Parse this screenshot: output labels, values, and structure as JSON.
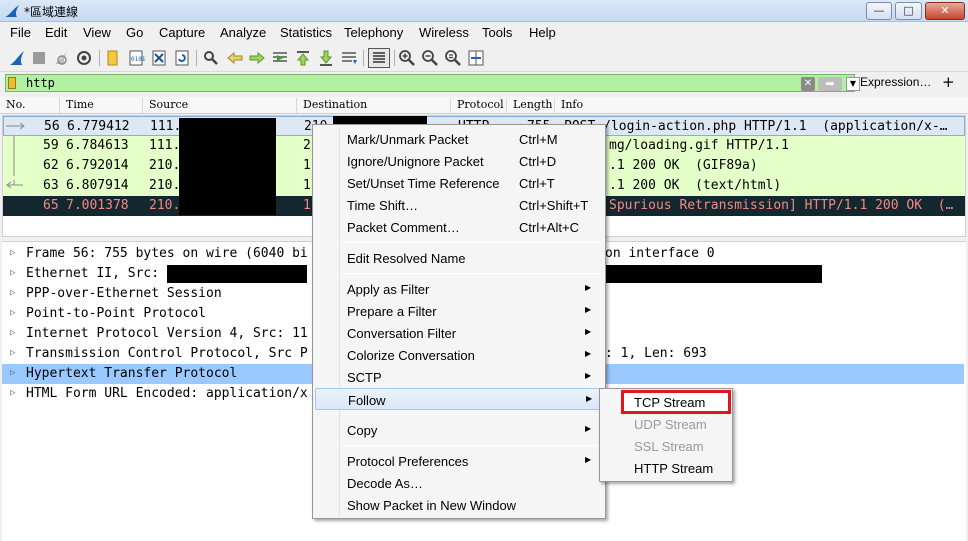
{
  "window": {
    "title": "*區域連線",
    "minimize": "—",
    "maximize": "□",
    "close": "✕"
  },
  "menu": [
    "File",
    "Edit",
    "View",
    "Go",
    "Capture",
    "Analyze",
    "Statistics",
    "Telephony",
    "Wireless",
    "Tools",
    "Help"
  ],
  "filter": {
    "value": "http",
    "clear": "✕",
    "apply": "➡",
    "dropdown": "▼",
    "expression_label": "Expression…",
    "add": "+"
  },
  "columns": [
    "No.",
    "Time",
    "Source",
    "Destination",
    "Protocol",
    "Length",
    "Info"
  ],
  "packets": [
    {
      "no": "56",
      "time": "6.779412",
      "src": "111.",
      "dst": "210",
      "proto": "HTTP",
      "len": "755",
      "info": "POST /login-action.php HTTP/1.1  (application/x-…"
    },
    {
      "no": "59",
      "time": "6.784613",
      "src": "111.",
      "dst": "2",
      "proto": "",
      "len": "",
      "info": "mg/loading.gif HTTP/1.1"
    },
    {
      "no": "62",
      "time": "6.792014",
      "src": "210.",
      "dst": "1",
      "proto": "",
      "len": "",
      "info": ".1 200 OK  (GIF89a)"
    },
    {
      "no": "63",
      "time": "6.807914",
      "src": "210.",
      "dst": "1",
      "proto": "",
      "len": "",
      "info": ".1 200 OK  (text/html)"
    },
    {
      "no": "65",
      "time": "7.001378",
      "src": "210.",
      "dst": "1",
      "proto": "",
      "len": "",
      "info": "Spurious Retransmission] HTTP/1.1 200 OK  (…"
    }
  ],
  "details": [
    {
      "left": "Frame 56: 755 bytes on wire (6040 bi",
      "right": "on interface 0"
    },
    {
      "left": "Ethernet II, Src: ",
      "right": ""
    },
    {
      "left": "PPP-over-Ethernet Session",
      "right": ""
    },
    {
      "left": "Point-to-Point Protocol",
      "right": ""
    },
    {
      "left": "Internet Protocol Version 4, Src: 11",
      "right": ""
    },
    {
      "left": "Transmission Control Protocol, Src P",
      "right": ": 1, Len: 693"
    },
    {
      "left": "Hypertext Transfer Protocol",
      "right": ""
    },
    {
      "left": "HTML Form URL Encoded: application/x",
      "right": ""
    }
  ],
  "context_menu": {
    "items": [
      {
        "label": "Mark/Unmark Packet",
        "shortcut": "Ctrl+M"
      },
      {
        "label": "Ignore/Unignore Packet",
        "shortcut": "Ctrl+D"
      },
      {
        "label": "Set/Unset Time Reference",
        "shortcut": "Ctrl+T"
      },
      {
        "label": "Time Shift…",
        "shortcut": "Ctrl+Shift+T"
      },
      {
        "label": "Packet Comment…",
        "shortcut": "Ctrl+Alt+C"
      },
      {
        "label": "Edit Resolved Name",
        "shortcut": ""
      },
      {
        "label": "Apply as Filter",
        "shortcut": ""
      },
      {
        "label": "Prepare a Filter",
        "shortcut": ""
      },
      {
        "label": "Conversation Filter",
        "shortcut": ""
      },
      {
        "label": "Colorize Conversation",
        "shortcut": ""
      },
      {
        "label": "SCTP",
        "shortcut": ""
      },
      {
        "label": "Follow",
        "shortcut": ""
      },
      {
        "label": "Copy",
        "shortcut": ""
      },
      {
        "label": "Protocol Preferences",
        "shortcut": ""
      },
      {
        "label": "Decode As…",
        "shortcut": ""
      },
      {
        "label": "Show Packet in New Window",
        "shortcut": ""
      }
    ],
    "submenu_arrow": "▶"
  },
  "follow_submenu": [
    {
      "label": "TCP Stream"
    },
    {
      "label": "UDP Stream"
    },
    {
      "label": "SSL Stream"
    },
    {
      "label": "HTTP Stream"
    }
  ],
  "colors": {
    "filter_valid": "#b0f0a0",
    "row_green": "#e4ffc7",
    "row_dark": "#12272e",
    "highlight_red": "#e0161c",
    "detail_selected": "#99c9ff"
  }
}
